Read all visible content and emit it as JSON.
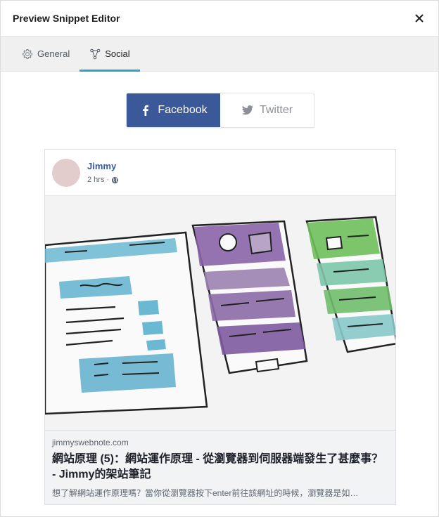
{
  "header": {
    "title": "Preview Snippet Editor",
    "close_label": "×"
  },
  "tabs": [
    {
      "label": "General",
      "icon": "gear-icon",
      "active": false
    },
    {
      "label": "Social",
      "icon": "share-icon",
      "active": true
    }
  ],
  "network_switch": {
    "facebook_label": "Facebook",
    "twitter_label": "Twitter",
    "selected": "Facebook"
  },
  "post": {
    "author": "Jimmy",
    "time": "2 hrs ·",
    "privacy_icon": "globe-icon"
  },
  "link": {
    "domain": "jimmyswebnote.com",
    "title": "網站原理 (5)：網站運作原理 - 從瀏覽器到伺服器端發生了甚麼事？ - Jimmy的架站筆記",
    "description": "想了解網站運作原理嗎？當你從瀏覽器按下enter前往該網址的時候，瀏覽器是如…"
  },
  "colors": {
    "facebook_blue": "#3b5998",
    "tab_underline": "#2da0c7",
    "author_link": "#385898"
  }
}
